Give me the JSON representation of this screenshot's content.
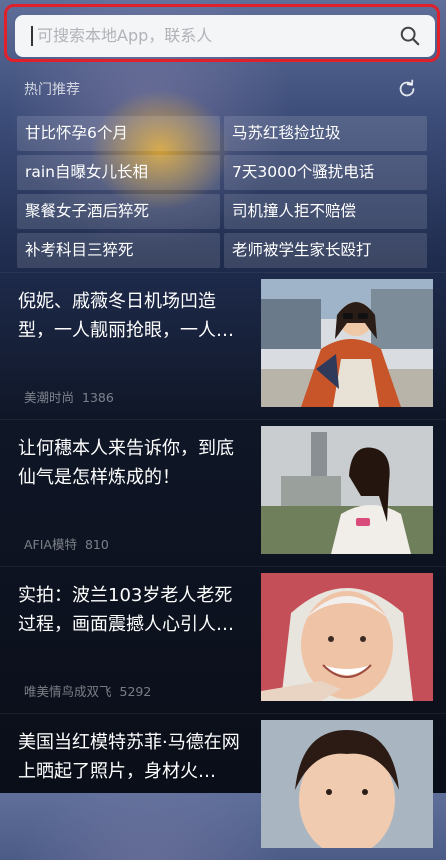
{
  "search": {
    "placeholder": "可搜索本地App，联系人"
  },
  "hot": {
    "title": "热门推荐",
    "items": [
      "甘比怀孕6个月",
      "马苏红毯捡垃圾",
      "rain自曝女儿长相",
      "7天3000个骚扰电话",
      "聚餐女子酒后猝死",
      "司机撞人拒不赔偿",
      "补考科目三猝死",
      "老师被学生家长殴打"
    ]
  },
  "feed": [
    {
      "title": "倪妮、戚薇冬日机场凹造型，一人靓丽抢眼，一人超…",
      "source": "美潮时尚",
      "count": "1386"
    },
    {
      "title": "让何穗本人来告诉你，到底仙气是怎样炼成的！",
      "source": "AFIA模特",
      "count": "810"
    },
    {
      "title": "实拍：波兰103岁老人老死过程，画面震撼人心引人…",
      "source": "唯美情鸟成双飞",
      "count": "5292"
    },
    {
      "title": "美国当红模特苏菲·马德在网上晒起了照片，身材火…",
      "source": "",
      "count": ""
    }
  ],
  "colors": {
    "highlight": "#e0202a",
    "search_bg": "#f4f5f7"
  }
}
